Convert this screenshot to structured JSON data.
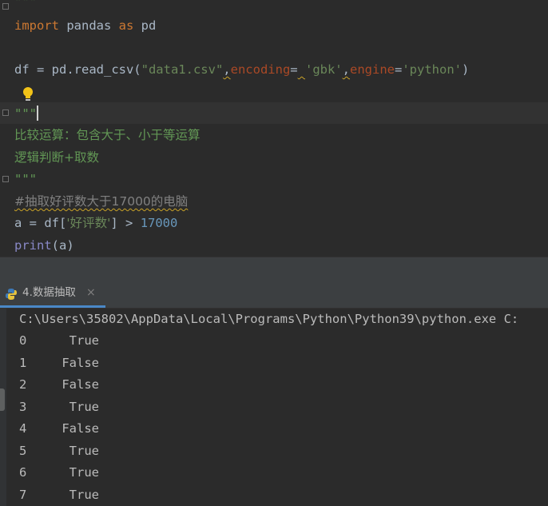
{
  "editor": {
    "line0": "\"\"\"",
    "line1": {
      "kw_import": "import",
      "mod": " pandas ",
      "kw_as": "as",
      "alias": " pd"
    },
    "line3": {
      "pre": "df = pd.read_csv(",
      "fname": "\"data1.csv\"",
      "comma1": ",",
      "p_encoding": "encoding",
      "eq1": "=",
      "space": " ",
      "enc": "'gbk'",
      "comma2": ",",
      "p_engine": "engine",
      "eq2": "=",
      "eng": "'python'",
      "close": ")"
    },
    "line5": "\"\"\"",
    "line6": "比较运算：包含大于、小于等运算",
    "line7": "逻辑判断+取数",
    "line8": "\"\"\"",
    "line9": "#抽取好评数大于17000的电脑",
    "line10": {
      "pre": "a = df[",
      "key": "'好评数'",
      "mid": "] > ",
      "num": "17000"
    },
    "line11": {
      "fn": "print",
      "args": "(a)"
    }
  },
  "run_tab": {
    "label": "4.数据抽取",
    "close": "×",
    "icon": "python-icon"
  },
  "console": {
    "command": "C:\\Users\\35802\\AppData\\Local\\Programs\\Python\\Python39\\python.exe C:",
    "rows": [
      {
        "index": "0",
        "value": "True"
      },
      {
        "index": "1",
        "value": "False"
      },
      {
        "index": "2",
        "value": "False"
      },
      {
        "index": "3",
        "value": "True"
      },
      {
        "index": "4",
        "value": "False"
      },
      {
        "index": "5",
        "value": "True"
      },
      {
        "index": "6",
        "value": "True"
      },
      {
        "index": "7",
        "value": "True"
      }
    ]
  },
  "colors": {
    "background": "#2b2b2b",
    "keyword": "#cc7832",
    "string": "#6a8759",
    "number": "#6897bb",
    "docstring": "#629755",
    "accent": "#4a88c7"
  }
}
